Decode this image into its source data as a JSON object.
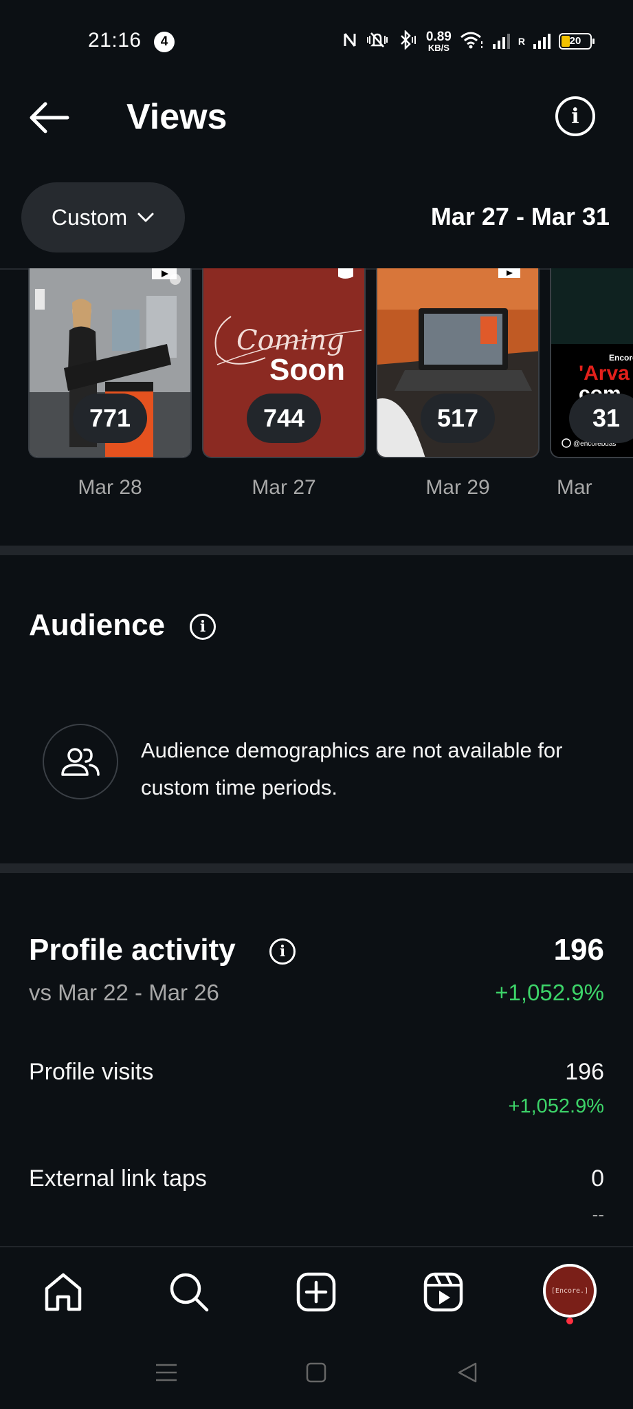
{
  "status_bar": {
    "time": "21:16",
    "notification_count": "4",
    "net_speed_value": "0.89",
    "net_speed_unit": "KB/S",
    "battery": "20",
    "roaming_label": "R"
  },
  "header": {
    "title": "Views"
  },
  "filter": {
    "period_label": "Custom",
    "date_range": "Mar 27 - Mar 31"
  },
  "thumbnails": [
    {
      "count": "771",
      "date": "Mar 28"
    },
    {
      "count": "744",
      "date": "Mar 27",
      "overlay_script": "Coming",
      "overlay_bold": "Soon"
    },
    {
      "count": "517",
      "date": "Mar 29"
    },
    {
      "count": "31",
      "date": "Mar",
      "overlay_tag": "Encore",
      "overlay_title1": "'Arva",
      "overlay_title2": "com",
      "overlay_handle": "@encorebuas"
    }
  ],
  "audience": {
    "title": "Audience",
    "message": "Audience demographics are not available for custom time periods."
  },
  "profile_activity": {
    "title": "Profile activity",
    "total": "196",
    "compare_label": "vs Mar 22 - Mar 26",
    "total_change": "+1,052.9%",
    "rows": [
      {
        "label": "Profile visits",
        "value": "196",
        "change": "+1,052.9%"
      },
      {
        "label": "External link taps",
        "value": "0",
        "change": "--"
      }
    ]
  },
  "bottom_nav": {
    "avatar_text": "[Encore.]"
  },
  "colors": {
    "background": "#0c1014",
    "positive": "#3dd469",
    "muted": "#a8a8a8",
    "pill": "#262a2f"
  }
}
